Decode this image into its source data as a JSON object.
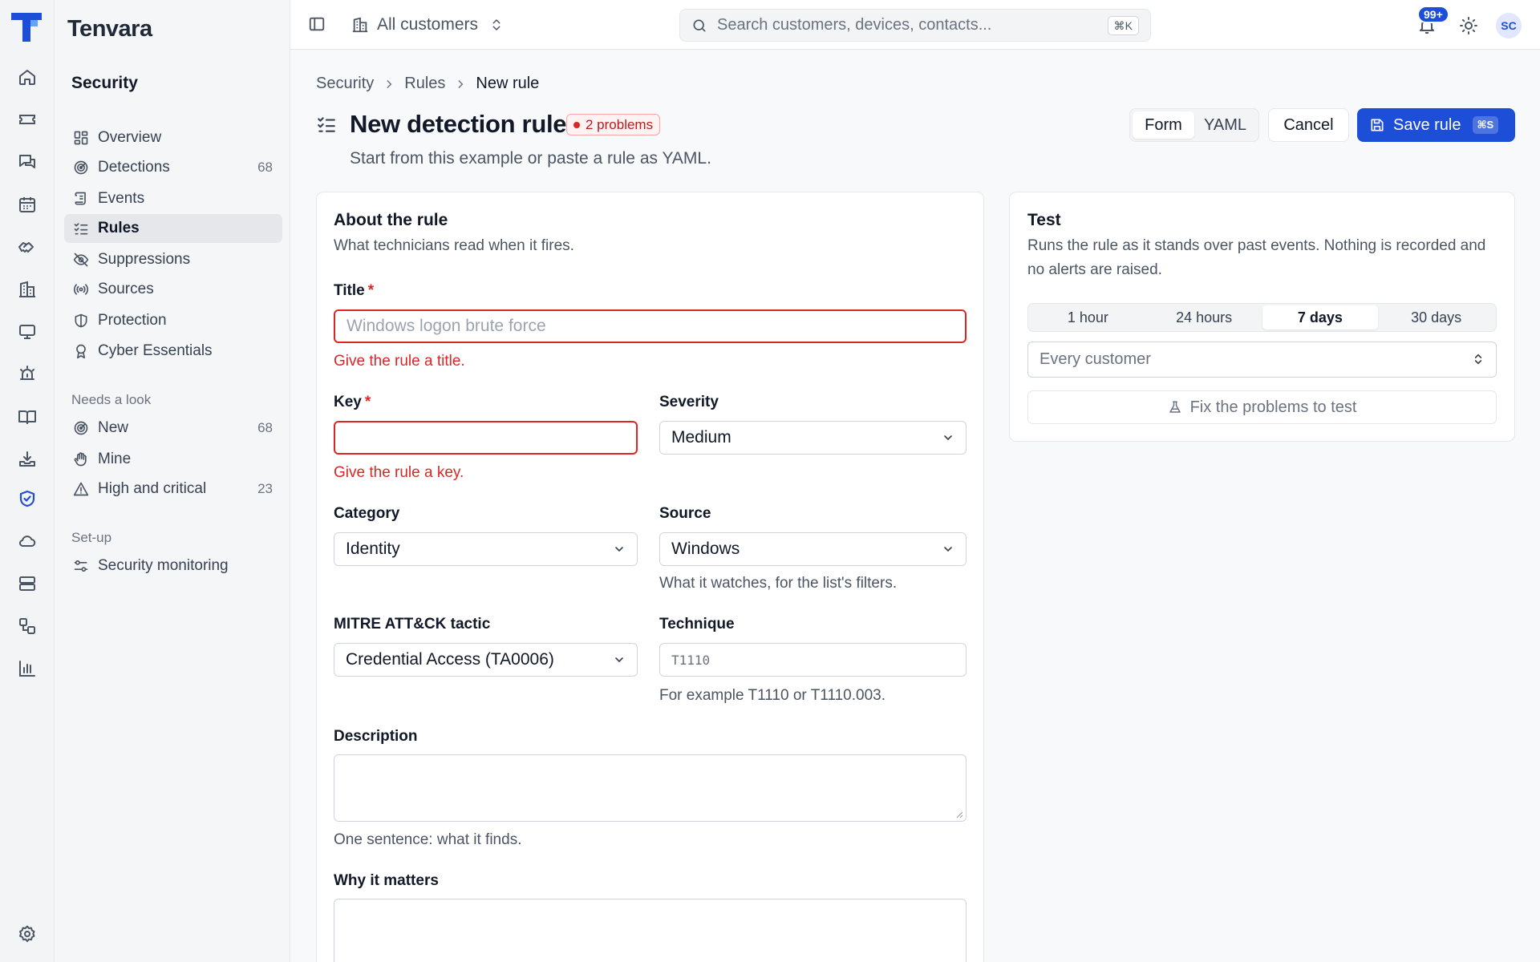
{
  "app": {
    "brand": "Tenvara"
  },
  "rail": {
    "icons": [
      "home-icon",
      "ticket-icon",
      "chat-icon",
      "calendar-icon",
      "handshake-icon",
      "building-icon",
      "monitor-icon",
      "alarm-icon",
      "book-icon",
      "download-tray-icon",
      "shield-check-icon",
      "cloud-icon",
      "server-icon",
      "workflow-icon",
      "bar-chart-icon",
      "settings-icon"
    ],
    "active": "shield-check-icon"
  },
  "sidebar": {
    "section": "Security",
    "items": [
      {
        "label": "Overview",
        "icon": "layout-grid-icon",
        "count": ""
      },
      {
        "label": "Detections",
        "icon": "radar-icon",
        "count": "68"
      },
      {
        "label": "Events",
        "icon": "scroll-icon",
        "count": ""
      },
      {
        "label": "Rules",
        "icon": "list-checks-icon",
        "count": ""
      },
      {
        "label": "Suppressions",
        "icon": "eye-off-icon",
        "count": ""
      },
      {
        "label": "Sources",
        "icon": "radio-icon",
        "count": ""
      },
      {
        "label": "Protection",
        "icon": "shield-icon",
        "count": ""
      },
      {
        "label": "Cyber Essentials",
        "icon": "award-icon",
        "count": ""
      }
    ],
    "active_item": "Rules",
    "group_needs_look": "Needs a look",
    "needs_look": [
      {
        "label": "New",
        "icon": "radar-icon",
        "count": "68"
      },
      {
        "label": "Mine",
        "icon": "hand-icon",
        "count": ""
      },
      {
        "label": "High and critical",
        "icon": "warning-icon",
        "count": "23"
      }
    ],
    "group_setup": "Set-up",
    "setup": [
      {
        "label": "Security monitoring",
        "icon": "sliders-icon",
        "count": ""
      }
    ]
  },
  "topbar": {
    "scope": "All customers",
    "search_placeholder": "Search customers, devices, contacts...",
    "search_shortcut": "⌘K",
    "notification_badge": "99+",
    "avatar_initials": "SC"
  },
  "breadcrumb": [
    "Security",
    "Rules",
    "New rule"
  ],
  "page": {
    "title": "New detection rule",
    "problems": "2 problems",
    "subtitle": "Start from this example or paste a rule as YAML."
  },
  "actions": {
    "view_options": [
      "Form",
      "YAML"
    ],
    "view_selected": "Form",
    "cancel": "Cancel",
    "save": "Save rule",
    "save_shortcut": "⌘S"
  },
  "form": {
    "heading": "About the rule",
    "subheading": "What technicians read when it fires.",
    "title": {
      "label": "Title",
      "placeholder": "Windows logon brute force",
      "value": "",
      "error": "Give the rule a title."
    },
    "key": {
      "label": "Key",
      "value": "",
      "error": "Give the rule a key."
    },
    "severity": {
      "label": "Severity",
      "value": "Medium"
    },
    "category": {
      "label": "Category",
      "value": "Identity"
    },
    "source": {
      "label": "Source",
      "value": "Windows",
      "help": "What it watches, for the list's filters."
    },
    "tactic": {
      "label": "MITRE ATT&CK tactic",
      "value": "Credential Access (TA0006)"
    },
    "technique": {
      "label": "Technique",
      "placeholder": "T1110",
      "help": "For example T1110 or T1110.003."
    },
    "description": {
      "label": "Description",
      "help": "One sentence: what it finds."
    },
    "why": {
      "label": "Why it matters"
    }
  },
  "test": {
    "heading": "Test",
    "description": "Runs the rule as it stands over past events. Nothing is recorded and no alerts are raised.",
    "ranges": [
      "1 hour",
      "24 hours",
      "7 days",
      "30 days"
    ],
    "range_selected": "7 days",
    "customer_placeholder": "Every customer",
    "run_label": "Fix the problems to test"
  },
  "colors": {
    "accent": "#1d4ed8",
    "error": "#dc2626"
  }
}
